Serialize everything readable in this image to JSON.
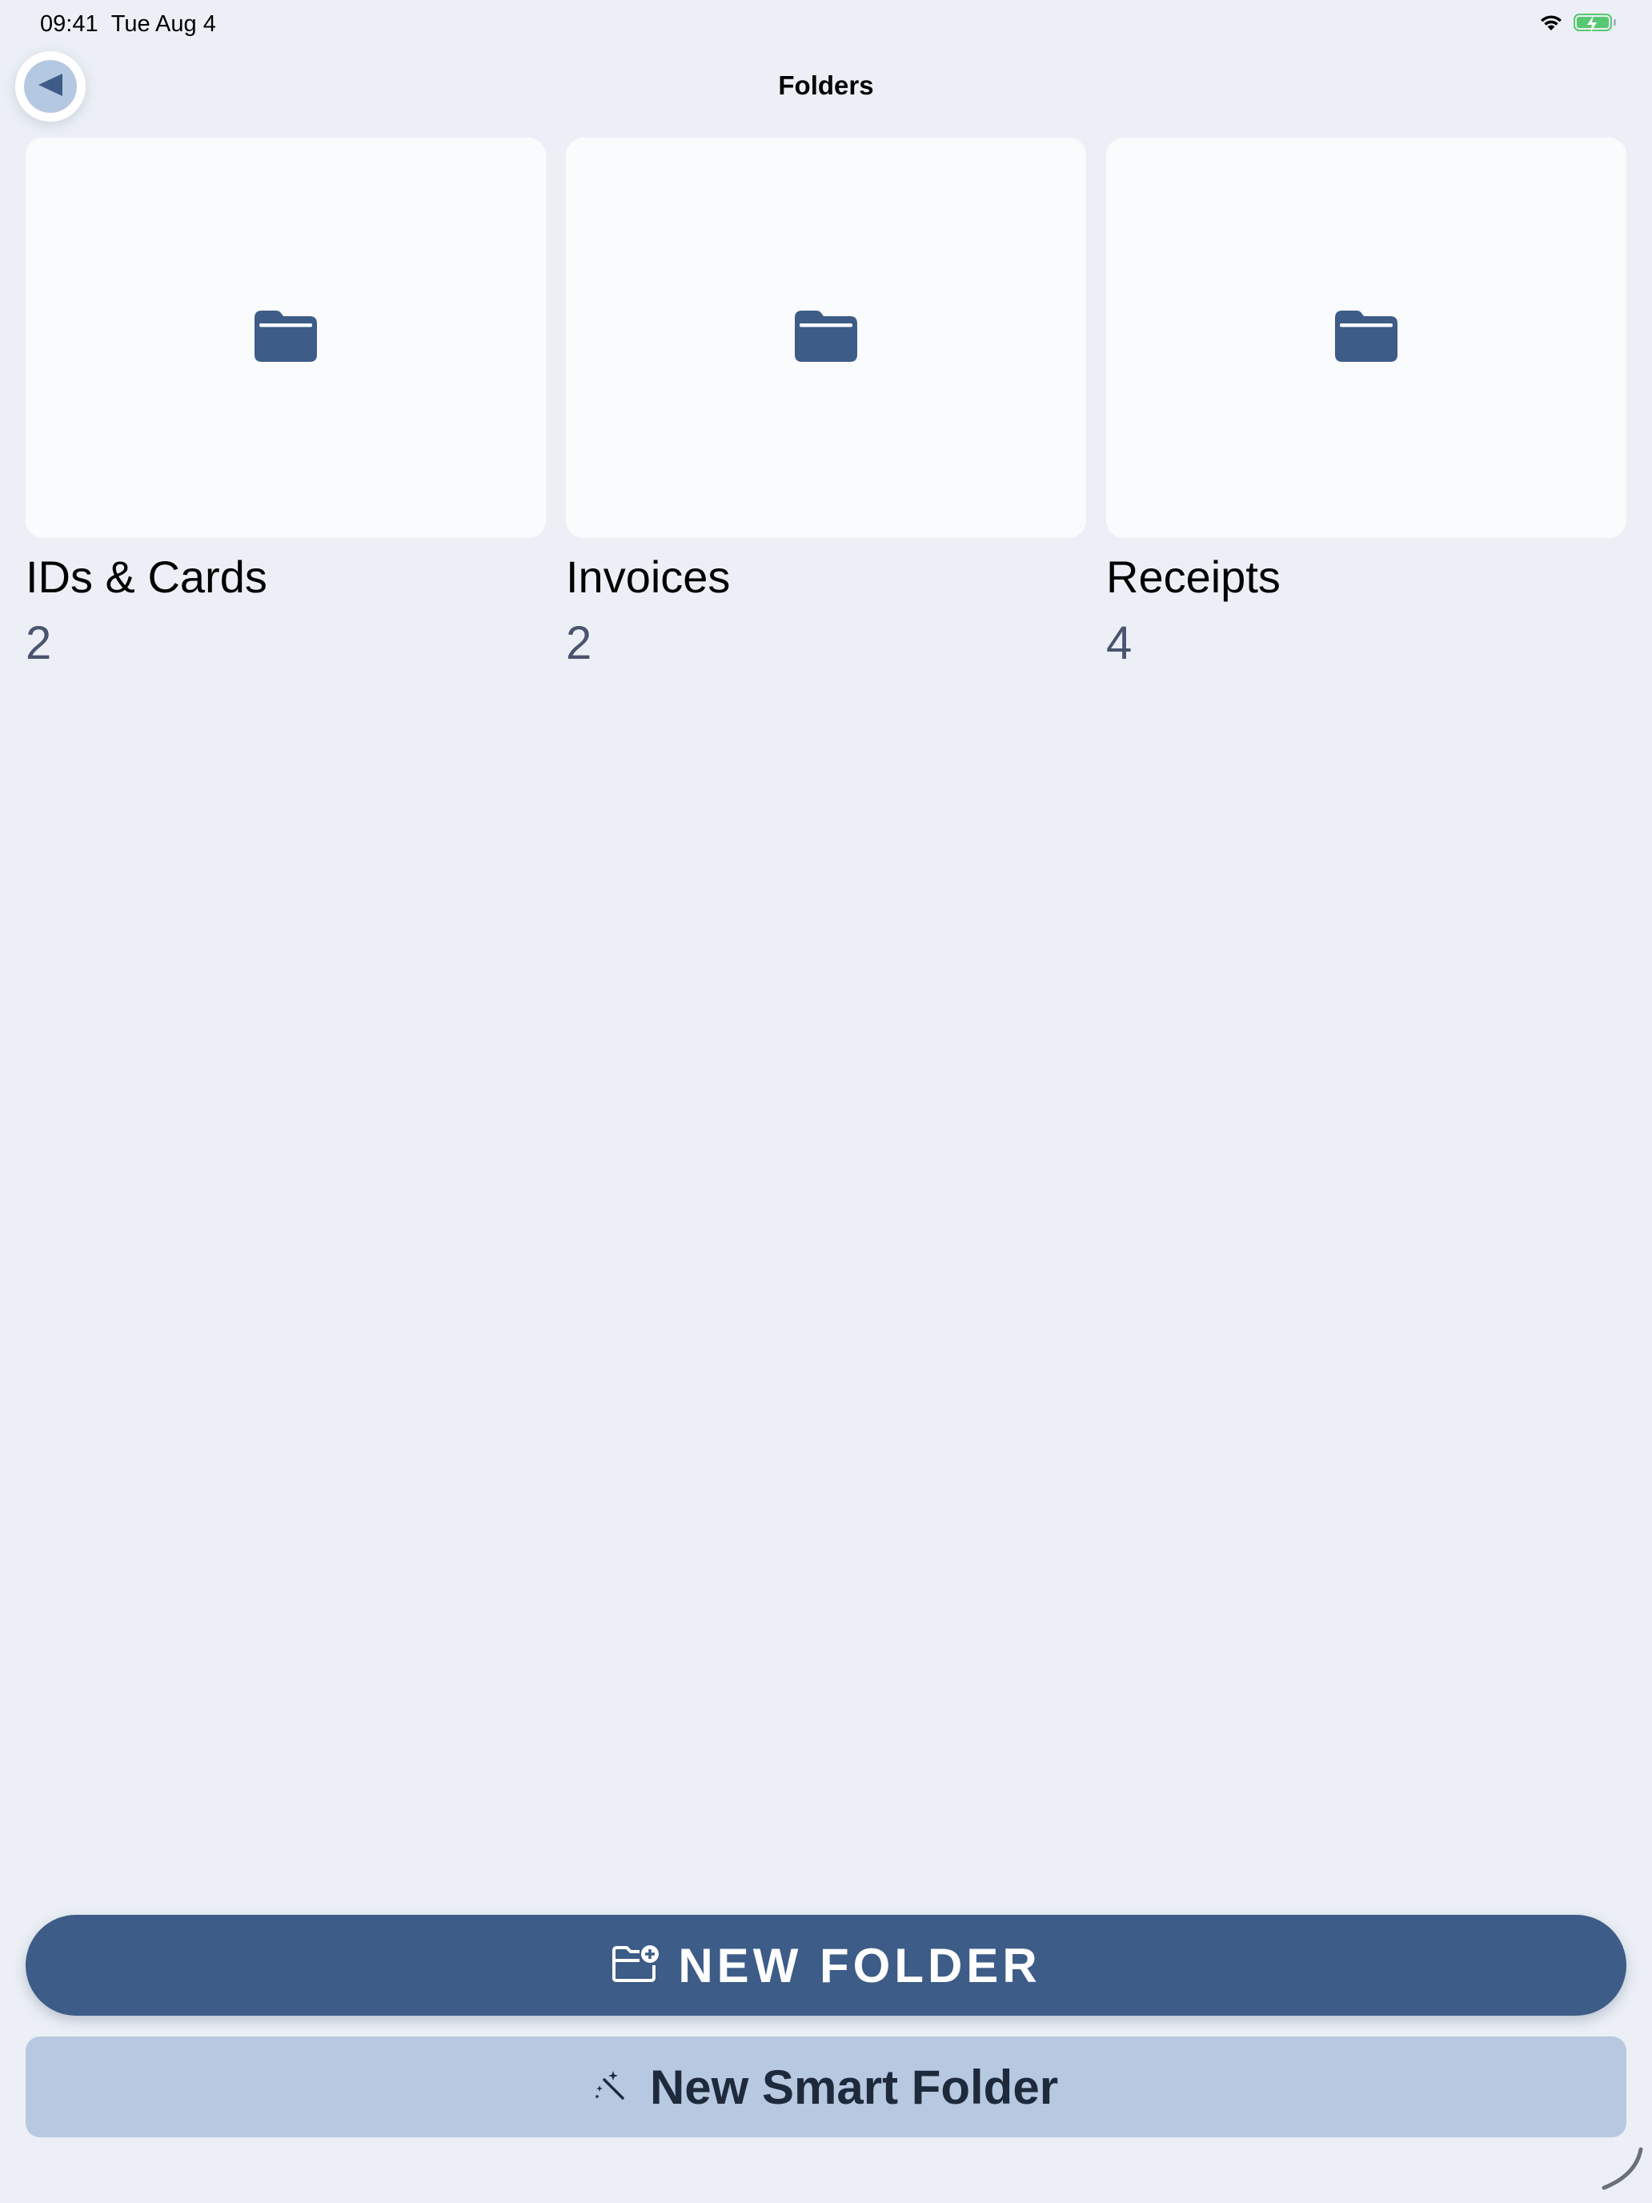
{
  "status_bar": {
    "time": "09:41",
    "date": "Tue Aug 4",
    "battery_color": "#57c872"
  },
  "nav": {
    "title": "Folders",
    "back_icon": "back-arrow-icon"
  },
  "folders": [
    {
      "name": "IDs & Cards",
      "count": "2",
      "icon": "folder-icon"
    },
    {
      "name": "Invoices",
      "count": "2",
      "icon": "folder-icon"
    },
    {
      "name": "Receipts",
      "count": "4",
      "icon": "folder-icon"
    }
  ],
  "actions": {
    "new_folder_label": "NEW FOLDER",
    "new_folder_icon": "folder-plus-icon",
    "new_smart_folder_label": "New Smart Folder",
    "new_smart_folder_icon": "magic-wand-icon"
  },
  "colors": {
    "background": "#ecf0f6",
    "card": "#fafbfd",
    "accent": "#3d5c87",
    "accent_light": "#b7c9e1",
    "folder_icon": "#3d5c87",
    "count_text": "#4a5470"
  }
}
